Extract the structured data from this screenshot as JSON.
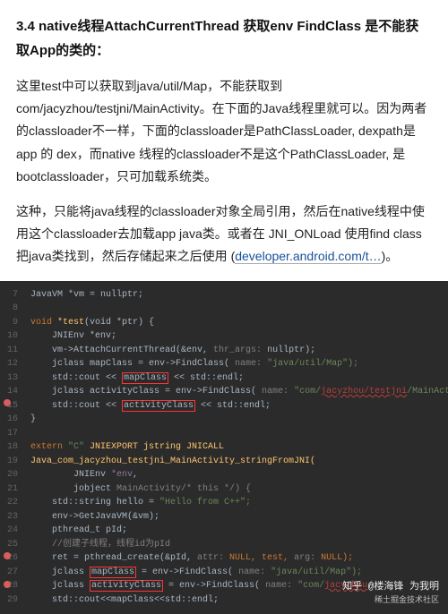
{
  "heading": "3.4 native线程AttachCurrentThread 获取env FindClass 是不能获取App的类的：",
  "para1": "这里test中可以获取到java/util/Map，不能获取到com/jacyzhou/testjni/MainActivity。在下面的Java线程里就可以。因为两者的classloader不一样，下面的classloader是PathClassLoader, dexpath是app 的 dex，而native 线程的classloader不是这个PathClassLoader, 是bootclassloader，只可加载系统类。",
  "para2a": "这种，只能将java线程的classloader对象全局引用，然后在native线程中使用这个classloader去加载app java类。或者在 JNI_ONLoad 使用find class 把java类找到，然后存储起来之后使用 (",
  "link": "developer.android.com/t…",
  "para2b": ")。",
  "code": {
    "l7": "JavaVM *vm = nullptr;",
    "l9a": "void ",
    "l9b": "*test",
    "l9c": "(void *ptr) {",
    "l10": "    JNIEnv *env;",
    "l11a": "    vm->AttachCurrentThread(&env, ",
    "l11b": "thr_args:",
    "l11c": " nullptr);",
    "l12a": "    jclass mapClass = env->FindClass( ",
    "l12b": "name:",
    "l12c": " \"java/util/Map\");",
    "l13a": "    std::cout << ",
    "l13b": "mapClass",
    "l13c": " << std::endl;",
    "l14a": "    jclass activityClass = env->FindClass( ",
    "l14b": "name:",
    "l14c": " \"com/",
    "l14d": "jacyzhou/testjni",
    "l14e": "/MainActivity\");",
    "l15a": "    std::cout << ",
    "l15b": "activityClass",
    "l15c": " << std::endl;",
    "l16": "}",
    "l18a": "extern ",
    "l18b": "\"C\"",
    "l18c": " JNIEXPORT jstring JNICALL",
    "l19": "Java_com_jacyzhou_testjni_MainActivity_stringFromJNI(",
    "l20a": "        JNIEnv ",
    "l20b": "*env",
    "l21a": "        jobject ",
    "l21b": "MainActivity",
    "l21c": "/* this */) {",
    "l22a": "    std::string hello = ",
    "l22b": "\"Hello from C++\";",
    "l23": "    env->GetJavaVM(&vm);",
    "l24": "    pthread_t pId;",
    "l25": "    //创建子线程，线程id为pId",
    "l26a": "    ret = pthread_create(&pId, ",
    "l26b": "attr:",
    "l26c": " NULL, test, ",
    "l26d": "arg:",
    "l26e": " NULL);",
    "l27a": "    jclass ",
    "l27b": "mapClass",
    "l27c": " = env->FindClass( ",
    "l27d": "name:",
    "l27e": " \"java/util/Map\");",
    "l28a": "    jclass ",
    "l28b": "activityClass",
    "l28c": " = env->FindClass( ",
    "l28d": "name:",
    "l28e": " \"com/",
    "l28f": "jacyzhou",
    "l28g": "/",
    "l29": "    std::cout<<mapClass<<std::endl;"
  },
  "lines": [
    "7",
    "8",
    "9",
    "10",
    "11",
    "12",
    "13",
    "14",
    "15",
    "16",
    "17",
    "18",
    "19",
    "20",
    "21",
    "22",
    "23",
    "24",
    "25",
    "26",
    "27",
    "28",
    "29"
  ],
  "wm1": "知乎 @楼海锋 为我明",
  "wm2": "稀土掘金技术社区"
}
